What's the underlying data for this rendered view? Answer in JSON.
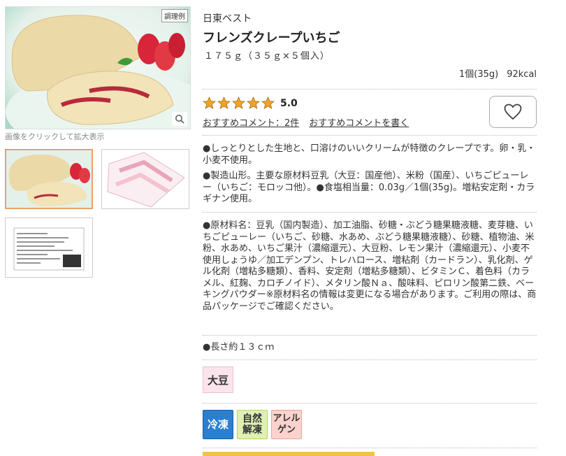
{
  "left": {
    "example_label": "調理例",
    "caption": "画像をクリックして拡大表示"
  },
  "product": {
    "brand": "日東ベスト",
    "title": "フレンズクレープいちご",
    "weight": "１７５ｇ（３５ｇ×５個入）",
    "serving": "1個(35g)",
    "kcal": "92kcal"
  },
  "rating": {
    "stars": 5,
    "score": "5.0",
    "comment_count_link": "おすすめコメント：2件",
    "write_comment_link": "おすすめコメントを書く"
  },
  "description": [
    "●しっとりとした生地と、口溶けのいいクリームが特徴のクレープです。卵・乳・小麦不使用。",
    "●製造山形。主要な原材料豆乳（大豆：国産他）、米粉（国産）、いちごピューレー（いちご：モロッコ他）。●食塩相当量：0.03g／1個(35g)。増粘安定剤・カラギナン使用。",
    "●原材料名：豆乳（国内製造）、加工油脂、砂糖・ぶどう糖果糖液糖、麦芽糖、いちごピューレー（いちご、砂糖、水あめ、ぶどう糖果糖液糖）、砂糖、植物油、米粉、水あめ、いちご果汁（濃縮還元）、大豆粉、レモン果汁（濃縮還元）、小麦不使用しょうゆ／加工デンプン、トレハロース、増粘剤（カードラン）、乳化剤、ゲル化剤（増粘多糖類）、香料、安定剤（増粘多糖類）、ビタミンＣ、着色料（カラメル、紅麹、カロチノイド）、メタリン酸Ｎａ、酸味料、ピロリン酸第二鉄、ベーキングパウダー※原材料名の情報は変更になる場合があります。ご利用の際は、商品パッケージでご確認ください。",
    "●長さ約１３ｃｍ"
  ],
  "allergen_badge": "大豆",
  "feature_icons": {
    "frozen": "冷凍",
    "natural_1": "自然",
    "natural_2": "解凍",
    "allergy_1": "アレル",
    "allergy_2": "ゲン"
  },
  "colors": {
    "star": "#f0a32a",
    "frozen": "#2a7fd0",
    "natural": "#dff0b0",
    "allergy": "#fbd2cd",
    "soy_badge": "#fbe4ec"
  }
}
